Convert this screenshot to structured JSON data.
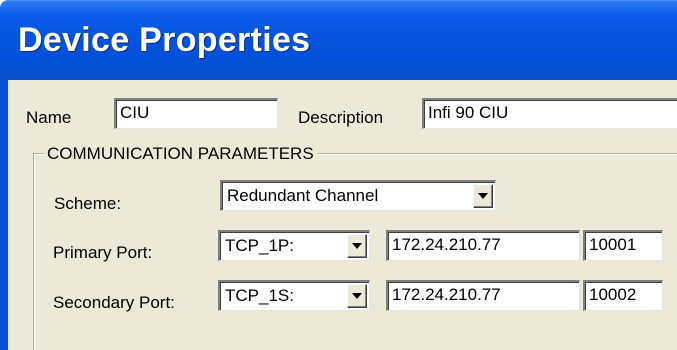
{
  "window": {
    "title": "Device Properties"
  },
  "device": {
    "name_label": "Name",
    "name_value": "CIU",
    "description_label": "Description",
    "description_value": "Infi 90 CIU"
  },
  "comm": {
    "group_title": "COMMUNICATION PARAMETERS",
    "scheme_label": "Scheme:",
    "scheme_value": "Redundant Channel",
    "primary_label": "Primary Port:",
    "primary_port": "TCP_1P:",
    "primary_ip": "172.24.210.77",
    "primary_num": "10001",
    "secondary_label": "Secondary Port:",
    "secondary_port": "TCP_1S:",
    "secondary_ip": "172.24.210.77",
    "secondary_num": "10002"
  },
  "icons": {
    "dropdown": "chevron-down-icon"
  },
  "colors": {
    "titlebar": "#0454dc",
    "dialog_bg": "#ece9d8",
    "title_text": "#ffffff"
  }
}
